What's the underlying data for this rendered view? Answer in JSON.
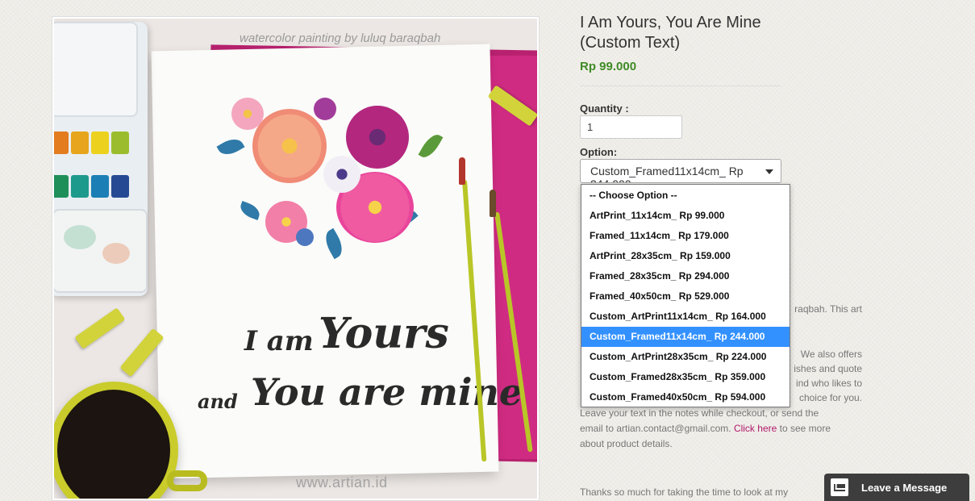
{
  "product": {
    "title": "I Am Yours, You Are Mine (Custom Text)",
    "price": "Rp 99.000",
    "image": {
      "watermark_top": "watercolor painting by luluq baraqbah",
      "watermark_bottom": "www.artian.id",
      "lettering_line1_a": "I am",
      "lettering_line1_b": "Yours",
      "lettering_line2_a": "and",
      "lettering_line2_b": "You are mine"
    }
  },
  "form": {
    "quantity_label": "Quantity :",
    "quantity_value": "1",
    "option_label": "Option:",
    "option_selected": "Custom_Framed11x14cm_ Rp 244.000",
    "options": [
      "-- Choose Option --",
      "ArtPrint_11x14cm_ Rp 99.000",
      "Framed_11x14cm_ Rp 179.000",
      "ArtPrint_28x35cm_ Rp 159.000",
      "Framed_28x35cm_ Rp 294.000",
      "Framed_40x50cm_ Rp 529.000",
      "Custom_ArtPrint11x14cm_ Rp 164.000",
      "Custom_Framed11x14cm_ Rp 244.000",
      "Custom_ArtPrint28x35cm_ Rp 224.000",
      "Custom_Framed28x35cm_ Rp 359.000",
      "Custom_Framed40x50cm_ Rp 594.000"
    ],
    "selected_index": 7
  },
  "description": {
    "line1_tail": "raqbah. This art",
    "fragment_offers": "We also offers",
    "fragment_quote": "ishes and quote",
    "fragment_likes": "ind who likes to",
    "fragment_choice": "choice for you.",
    "line_leave": "Leave your text in the notes while checkout, or send the",
    "line_email_pre": "email to artian.contact@gmail.com.",
    "link_click_here": "Click here",
    "line_email_post": "to see more",
    "line_about": "about product details.",
    "line_thanks": "Thanks so much for taking the time to look at my"
  },
  "chat": {
    "label": "Leave a Message",
    "icon": "mail-icon"
  },
  "colors": {
    "price_green": "#3f8b24",
    "link_magenta": "#b0196a",
    "dropdown_highlight": "#3391ff",
    "chat_bg": "#3d3d3d"
  }
}
